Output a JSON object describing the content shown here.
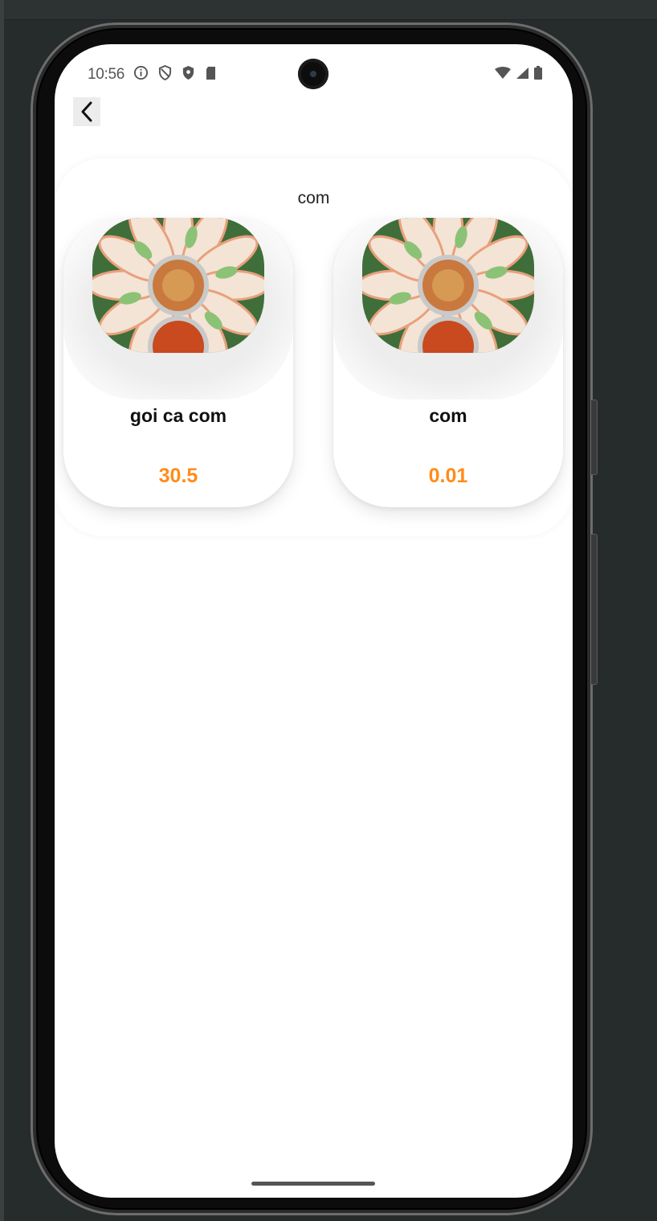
{
  "status_bar": {
    "time": "10:56",
    "left_icons": [
      "info-icon",
      "shield-outline-icon",
      "shield-filled-icon",
      "sim-card-icon"
    ],
    "right_icons": [
      "wifi-icon",
      "signal-icon",
      "battery-icon"
    ]
  },
  "toolbar": {
    "back_icon": "chevron-left-icon"
  },
  "category": {
    "title": "com",
    "items": [
      {
        "name": "goi ca com",
        "price": "30.5"
      },
      {
        "name": "com",
        "price": "0.01"
      }
    ]
  },
  "colors": {
    "price": "#ff8c1a",
    "background": "#ffffff",
    "frame": "#262b2c"
  }
}
